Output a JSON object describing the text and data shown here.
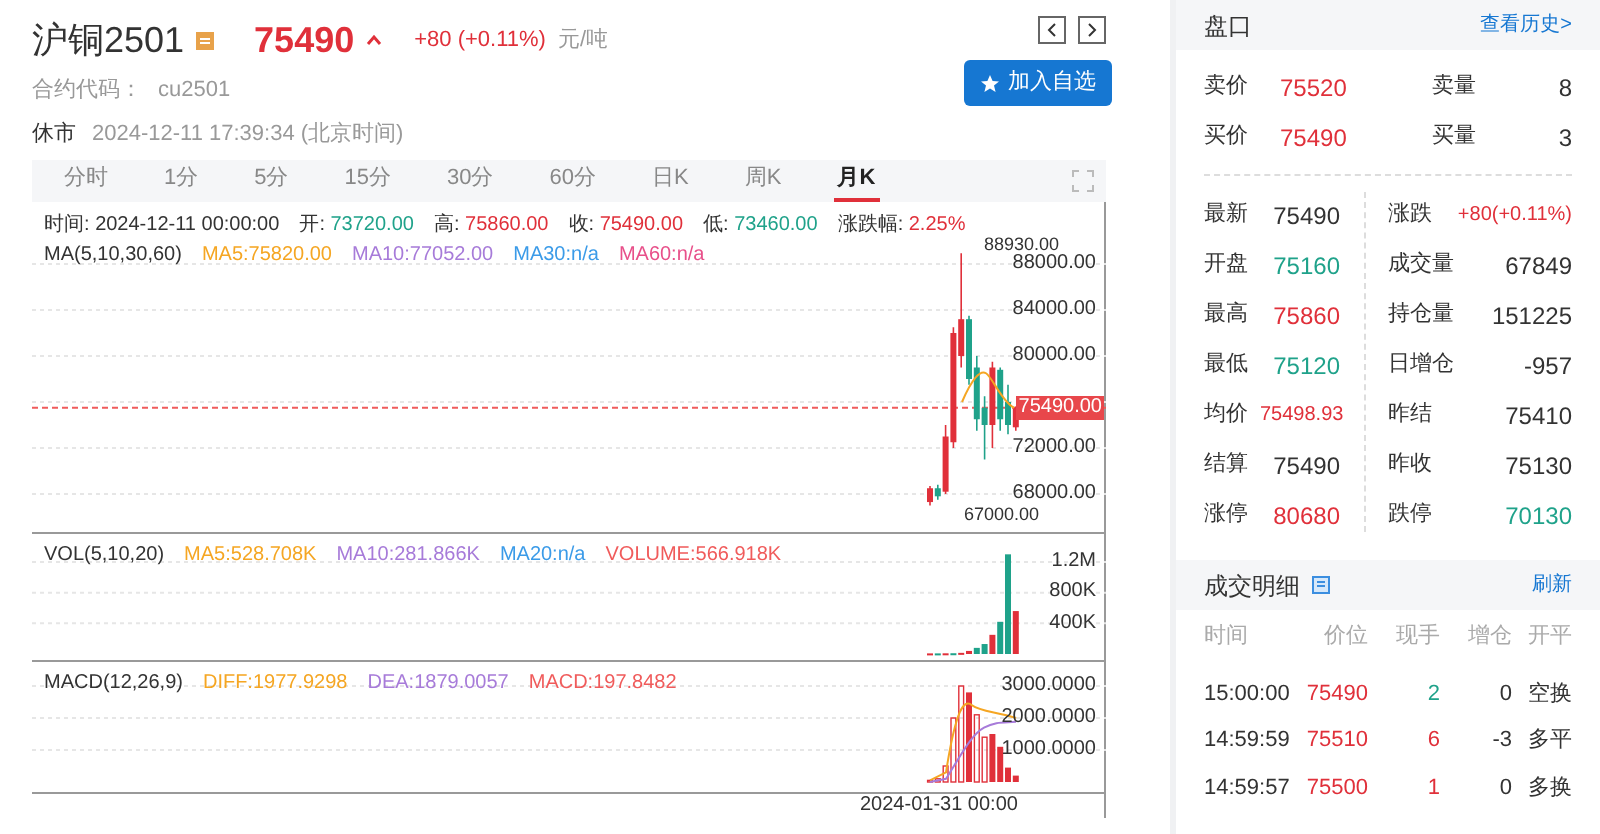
{
  "header": {
    "name": "沪铜2501",
    "price": "75490",
    "change": "+80 (+0.11%)",
    "unit": "元/吨",
    "code_label": "合约代码：",
    "code": "cu2501",
    "status": "休市",
    "time": "2024-12-11 17:39:34 (北京时间)",
    "watch_button": "加入自选"
  },
  "period_tabs": [
    {
      "label": "分时",
      "selected": false
    },
    {
      "label": "1分",
      "selected": false
    },
    {
      "label": "5分",
      "selected": false
    },
    {
      "label": "15分",
      "selected": false
    },
    {
      "label": "30分",
      "selected": false
    },
    {
      "label": "60分",
      "selected": false
    },
    {
      "label": "日K",
      "selected": false
    },
    {
      "label": "周K",
      "selected": false
    },
    {
      "label": "月K",
      "selected": true
    }
  ],
  "chart": {
    "info": [
      {
        "label": "时间:",
        "value": "2024-12-11 00:00:00",
        "color": "#333333"
      },
      {
        "label": "开:",
        "value": "73720.00",
        "color": "#1fa28a"
      },
      {
        "label": "高:",
        "value": "75860.00",
        "color": "#e0303a"
      },
      {
        "label": "收:",
        "value": "75490.00",
        "color": "#e0303a"
      },
      {
        "label": "低:",
        "value": "73460.00",
        "color": "#1fa28a"
      },
      {
        "label": "涨跌幅:",
        "value": "2.25%",
        "color": "#e0303a"
      }
    ],
    "ma_label": "MA(5,10,30,60)",
    "ma": [
      {
        "text": "MA5:75820.00",
        "color": "#f5a623"
      },
      {
        "text": "MA10:77052.00",
        "color": "#a77bd9"
      },
      {
        "text": "MA30:n/a",
        "color": "#3b9be8"
      },
      {
        "text": "MA60:n/a",
        "color": "#e8508a"
      }
    ],
    "high_mark": "88930.00",
    "low_mark": "67000.00",
    "price_ticks": [
      "88000.00",
      "84000.00",
      "80000.00",
      "72000.00",
      "68000.00"
    ],
    "price_tag": "75490.00",
    "vol_label": "VOL(5,10,20)",
    "vol_ma": [
      {
        "text": "MA5:528.708K",
        "color": "#f5a623"
      },
      {
        "text": "MA10:281.866K",
        "color": "#a77bd9"
      },
      {
        "text": "MA20:n/a",
        "color": "#3b9be8"
      },
      {
        "text": "VOLUME:566.918K",
        "color": "#f05b5b"
      }
    ],
    "vol_ticks": [
      "1.2M",
      "800K",
      "400K"
    ],
    "macd_label": "MACD(12,26,9)",
    "macd_lines": [
      {
        "text": "DIFF:1977.9298",
        "color": "#f5a623"
      },
      {
        "text": "DEA:1879.0057",
        "color": "#a77bd9"
      },
      {
        "text": "MACD:197.8482",
        "color": "#f05b5b"
      }
    ],
    "macd_ticks": [
      "3000.0000",
      "2000.0000",
      "1000.0000"
    ],
    "x_label": "2024-01-31 00:00"
  },
  "quote": {
    "title": "盘口",
    "history_link": "查看历史>",
    "order_book": [
      {
        "label": "卖价",
        "value": "75520",
        "color": "#e0303a",
        "qty_label": "卖量",
        "qty": "8"
      },
      {
        "label": "买价",
        "value": "75490",
        "color": "#e0303a",
        "qty_label": "买量",
        "qty": "3"
      }
    ],
    "stats": [
      {
        "left": {
          "label": "最新",
          "value": "75490",
          "color": "#333333"
        },
        "right": {
          "label": "涨跌",
          "value": "+80(+0.11%)",
          "color": "#e0303a"
        }
      },
      {
        "left": {
          "label": "开盘",
          "value": "75160",
          "color": "#1fa28a"
        },
        "right": {
          "label": "成交量",
          "value": "67849",
          "color": "#333333"
        }
      },
      {
        "left": {
          "label": "最高",
          "value": "75860",
          "color": "#e0303a"
        },
        "right": {
          "label": "持仓量",
          "value": "151225",
          "color": "#333333"
        }
      },
      {
        "left": {
          "label": "最低",
          "value": "75120",
          "color": "#1fa28a"
        },
        "right": {
          "label": "日增仓",
          "value": "-957",
          "color": "#333333"
        }
      },
      {
        "left": {
          "label": "均价",
          "value": "75498.93",
          "color": "#e0303a"
        },
        "right": {
          "label": "昨结",
          "value": "75410",
          "color": "#333333"
        }
      },
      {
        "left": {
          "label": "结算",
          "value": "75490",
          "color": "#333333"
        },
        "right": {
          "label": "昨收",
          "value": "75130",
          "color": "#333333"
        }
      },
      {
        "left": {
          "label": "涨停",
          "value": "80680",
          "color": "#e0303a"
        },
        "right": {
          "label": "跌停",
          "value": "70130",
          "color": "#1fa28a"
        }
      }
    ]
  },
  "trades": {
    "title": "成交明细",
    "refresh": "刷新",
    "columns": [
      "时间",
      "价位",
      "现手",
      "增仓",
      "开平"
    ],
    "rows": [
      {
        "time": "15:00:00",
        "price": {
          "text": "75490",
          "color": "#e0303a"
        },
        "volume": {
          "text": "2",
          "color": "#1fa28a"
        },
        "oi_change": "0",
        "type": "空换"
      },
      {
        "time": "14:59:59",
        "price": {
          "text": "75510",
          "color": "#e0303a"
        },
        "volume": {
          "text": "6",
          "color": "#e0303a"
        },
        "oi_change": "-3",
        "type": "多平"
      },
      {
        "time": "14:59:57",
        "price": {
          "text": "75500",
          "color": "#e0303a"
        },
        "volume": {
          "text": "1",
          "color": "#e0303a"
        },
        "oi_change": "0",
        "type": "多换"
      }
    ]
  }
}
